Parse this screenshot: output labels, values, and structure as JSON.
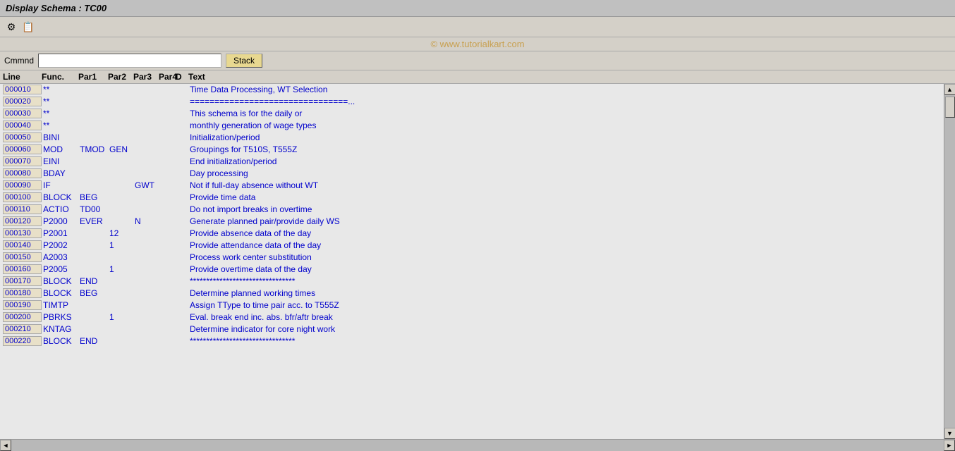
{
  "title": "Display Schema : TC00",
  "watermark": "© www.tutorialkart.com",
  "command": {
    "label": "Cmmnd",
    "placeholder": "",
    "stack_button": "Stack"
  },
  "columns": {
    "line": "Line",
    "func": "Func.",
    "par1": "Par1",
    "par2": "Par2",
    "par3": "Par3",
    "par4": "Par4",
    "d": "D",
    "text": "Text"
  },
  "rows": [
    {
      "line": "000010",
      "func": "**",
      "par1": "",
      "par2": "",
      "par3": "",
      "par4": "",
      "d": "",
      "text": "Time Data Processing, WT Selection"
    },
    {
      "line": "000020",
      "func": "**",
      "par1": "",
      "par2": "",
      "par3": "",
      "par4": "",
      "d": "",
      "text": "================================..."
    },
    {
      "line": "000030",
      "func": "**",
      "par1": "",
      "par2": "",
      "par3": "",
      "par4": "",
      "d": "",
      "text": "This schema is for the daily or"
    },
    {
      "line": "000040",
      "func": "**",
      "par1": "",
      "par2": "",
      "par3": "",
      "par4": "",
      "d": "",
      "text": "monthly generation of wage types"
    },
    {
      "line": "000050",
      "func": "BINI",
      "par1": "",
      "par2": "",
      "par3": "",
      "par4": "",
      "d": "",
      "text": "Initialization/period"
    },
    {
      "line": "000060",
      "func": "MOD",
      "par1": "TMOD",
      "par2": "GEN",
      "par3": "",
      "par4": "",
      "d": "",
      "text": "Groupings for T510S, T555Z"
    },
    {
      "line": "000070",
      "func": "EINI",
      "par1": "",
      "par2": "",
      "par3": "",
      "par4": "",
      "d": "",
      "text": "End initialization/period"
    },
    {
      "line": "000080",
      "func": "BDAY",
      "par1": "",
      "par2": "",
      "par3": "",
      "par4": "",
      "d": "",
      "text": "Day processing"
    },
    {
      "line": "000090",
      "func": "IF",
      "par1": "",
      "par2": "",
      "par3": "GWT",
      "par4": "",
      "d": "",
      "text": "Not if full-day absence without WT"
    },
    {
      "line": "000100",
      "func": "BLOCK",
      "par1": "BEG",
      "par2": "",
      "par3": "",
      "par4": "",
      "d": "",
      "text": "Provide time data"
    },
    {
      "line": "000110",
      "func": "ACTIO",
      "par1": "TD00",
      "par2": "",
      "par3": "",
      "par4": "",
      "d": "",
      "text": "Do not import breaks in overtime"
    },
    {
      "line": "000120",
      "func": "P2000",
      "par1": "EVER",
      "par2": "",
      "par3": "N",
      "par4": "",
      "d": "",
      "text": "Generate planned pair/provide daily WS"
    },
    {
      "line": "000130",
      "func": "P2001",
      "par1": "",
      "par2": "12",
      "par3": "",
      "par4": "",
      "d": "",
      "text": "Provide absence data of the day"
    },
    {
      "line": "000140",
      "func": "P2002",
      "par1": "",
      "par2": "1",
      "par3": "",
      "par4": "",
      "d": "",
      "text": "Provide attendance data of the day"
    },
    {
      "line": "000150",
      "func": "A2003",
      "par1": "",
      "par2": "",
      "par3": "",
      "par4": "",
      "d": "",
      "text": "Process work center substitution"
    },
    {
      "line": "000160",
      "func": "P2005",
      "par1": "",
      "par2": "1",
      "par3": "",
      "par4": "",
      "d": "",
      "text": "Provide overtime data of the day"
    },
    {
      "line": "000170",
      "func": "BLOCK",
      "par1": "END",
      "par2": "",
      "par3": "",
      "par4": "",
      "d": "",
      "text": "********************************"
    },
    {
      "line": "000180",
      "func": "BLOCK",
      "par1": "BEG",
      "par2": "",
      "par3": "",
      "par4": "",
      "d": "",
      "text": "Determine planned working times"
    },
    {
      "line": "000190",
      "func": "TIMTP",
      "par1": "",
      "par2": "",
      "par3": "",
      "par4": "",
      "d": "",
      "text": "Assign TType to time pair acc. to T555Z"
    },
    {
      "line": "000200",
      "func": "PBRKS",
      "par1": "",
      "par2": "1",
      "par3": "",
      "par4": "",
      "d": "",
      "text": "Eval. break end inc. abs. bfr/aftr break"
    },
    {
      "line": "000210",
      "func": "KNTAG",
      "par1": "",
      "par2": "",
      "par3": "",
      "par4": "",
      "d": "",
      "text": "Determine indicator for core night work"
    },
    {
      "line": "000220",
      "func": "BLOCK",
      "par1": "END",
      "par2": "",
      "par3": "",
      "par4": "",
      "d": "",
      "text": "********************************"
    }
  ],
  "toolbar": {
    "icon1": "⚙",
    "icon2": "📋"
  }
}
